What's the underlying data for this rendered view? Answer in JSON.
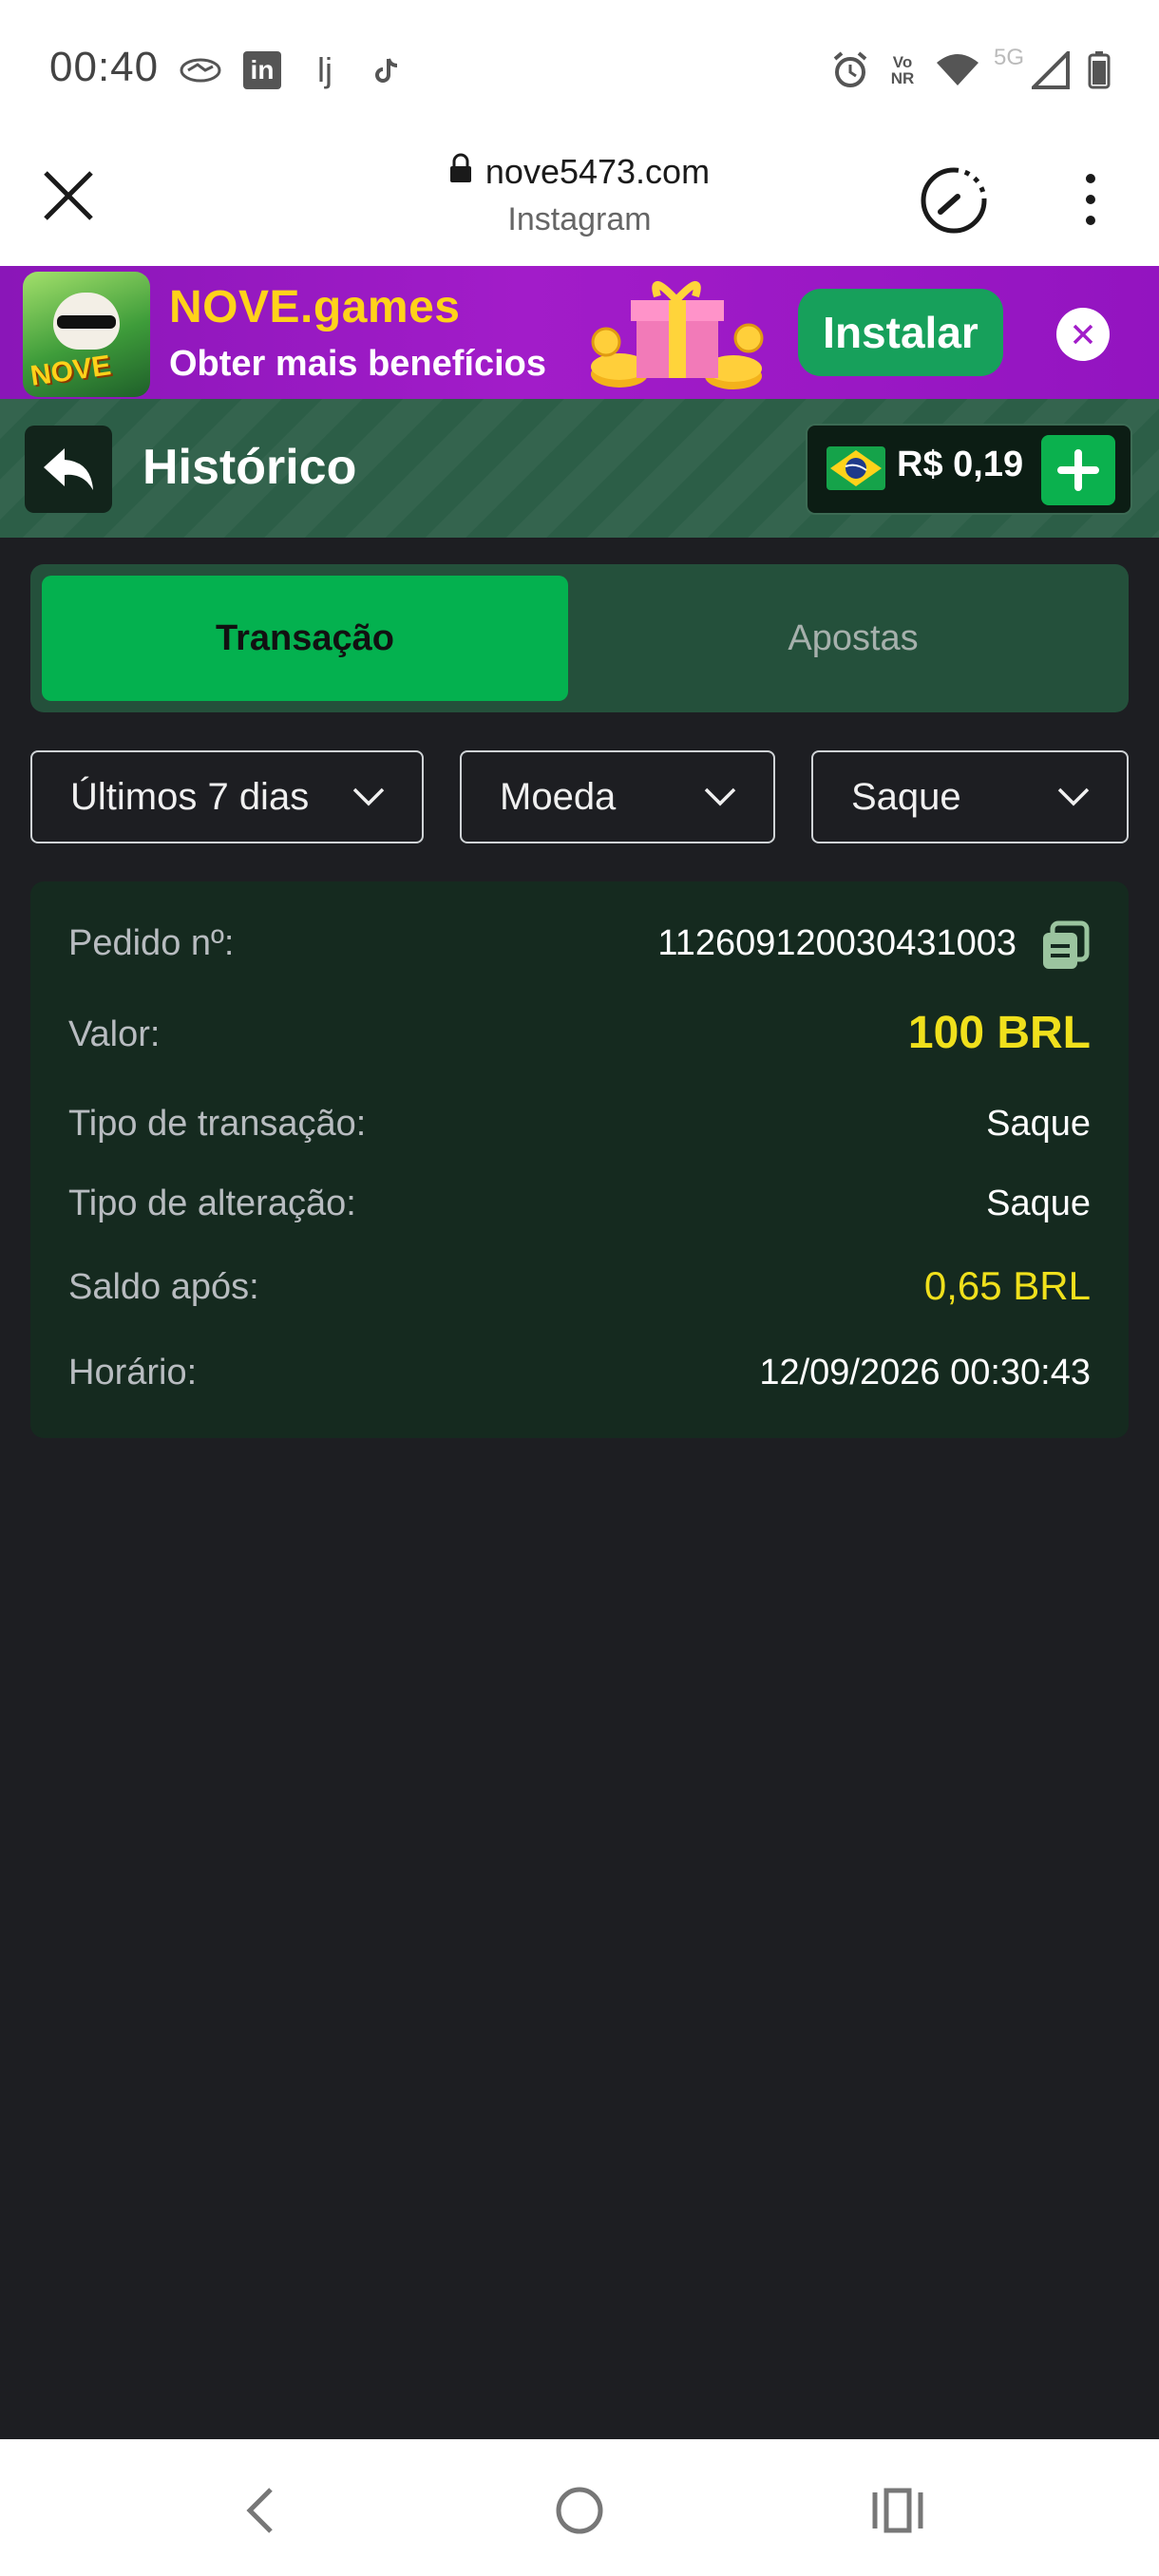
{
  "status_bar": {
    "time": "00:40",
    "left_icons": [
      "handshake-icon",
      "linkedin-icon",
      "lj-icon",
      "tiktok-icon"
    ],
    "right_icons": [
      "alarm-icon",
      "vonr-icon",
      "wifi-icon",
      "5g-icon",
      "signal-icon",
      "battery-icon"
    ],
    "vonr_text": "Vo NR",
    "network_text": "5G",
    "linkedin_text": "in",
    "lj_text": "lj"
  },
  "browser": {
    "url": "nove5473.com",
    "subtitle": "Instagram"
  },
  "banner": {
    "brand": "NOVE.games",
    "tagline": "Obter mais benefícios",
    "install_label": "Instalar",
    "logo_text": "NOVE"
  },
  "header": {
    "title": "Histórico",
    "balance": "R$ 0,19"
  },
  "tabs": [
    {
      "label": "Transação",
      "active": true
    },
    {
      "label": "Apostas",
      "active": false
    }
  ],
  "filters": {
    "period": "Últimos 7 dias",
    "currency": "Moeda",
    "type": "Saque"
  },
  "transaction": {
    "order_label": "Pedido nº:",
    "order_value": "112609120030431003",
    "amount_label": "Valor:",
    "amount_value": "100 BRL",
    "tx_type_label": "Tipo de transação:",
    "tx_type_value": "Saque",
    "change_type_label": "Tipo de alteração:",
    "change_type_value": "Saque",
    "balance_after_label": "Saldo após:",
    "balance_after_value": "0,65 BRL",
    "time_label": "Horário:",
    "time_value": "12/09/2026 00:30:43"
  },
  "colors": {
    "accent_green": "#04b14f",
    "header_green": "#2c5e47",
    "highlight_yellow": "#f0e01c",
    "banner_purple": "#9314c0"
  }
}
